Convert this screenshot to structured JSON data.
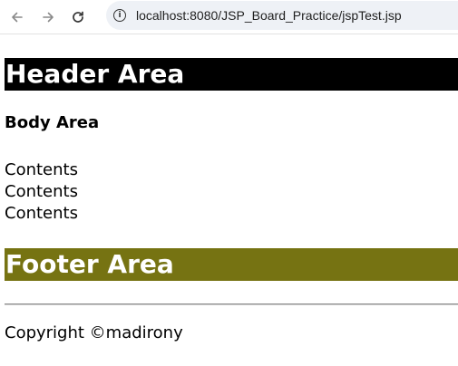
{
  "browser": {
    "url": "localhost:8080/JSP_Board_Practice/jspTest.jsp",
    "icons": {
      "back": "arrow-left-icon",
      "forward": "arrow-right-icon",
      "reload": "reload-icon",
      "site_info": "info-icon"
    }
  },
  "page": {
    "header": "Header Area",
    "body_title": "Body Area",
    "contents": [
      "Contents",
      "Contents",
      "Contents"
    ],
    "footer": "Footer Area",
    "copyright": "Copyright ©madirony"
  },
  "colors": {
    "header_bg": "#000000",
    "footer_bg": "#767312",
    "omnibox_bg": "#eef1f6"
  }
}
